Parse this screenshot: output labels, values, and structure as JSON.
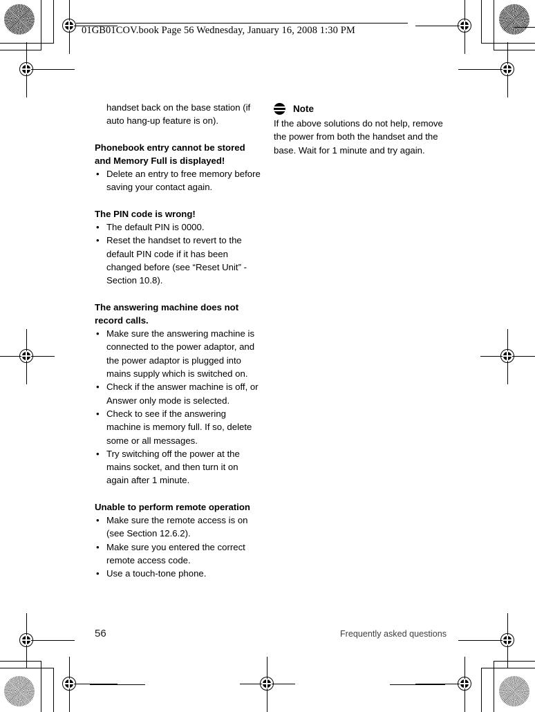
{
  "header": {
    "line": "01GB01COV.book  Page 56  Wednesday, January 16, 2008  1:30 PM"
  },
  "footer": {
    "page_number": "56",
    "section_title": "Frequently asked questions"
  },
  "left_column": {
    "continued_paragraph": "handset back on the base station (if auto hang-up feature is on).",
    "sections": [
      {
        "heading": "Phonebook entry cannot be stored and Memory Full is displayed!",
        "bullets": [
          "Delete an entry to free memory before saving your contact again."
        ]
      },
      {
        "heading": "The PIN code is wrong!",
        "bullets": [
          "The default PIN is 0000.",
          "Reset the handset to revert to the default PIN code if it has been changed before (see “Reset Unit” - Section 10.8)."
        ]
      },
      {
        "heading": "The answering machine does not record calls.",
        "bullets": [
          "Make sure the answering machine is connected to the power adaptor, and the power adaptor is plugged into mains supply which is switched on.",
          "Check if the answer machine is off, or Answer only mode is selected.",
          "Check to see if the answering machine is memory full. If so, delete some or all messages.",
          "Try switching off the power at the mains socket, and then turn it on again after 1 minute."
        ]
      },
      {
        "heading": "Unable to perform remote operation",
        "bullets": [
          "Make sure the remote access is on (see Section 12.6.2).",
          "Make sure you entered the correct remote access code.",
          "Use a touch-tone phone."
        ]
      }
    ],
    "bullet_glyph": "•"
  },
  "right_column": {
    "note": {
      "icon": "note-stripes-icon",
      "title": "Note",
      "body": "If the above solutions do not help, remove the power from both the handset and the base. Wait for 1 minute and try again."
    }
  },
  "print_marks": {
    "registration_icon": "registration-target-icon",
    "color_target_icon": "starburst-color-target-icon"
  }
}
